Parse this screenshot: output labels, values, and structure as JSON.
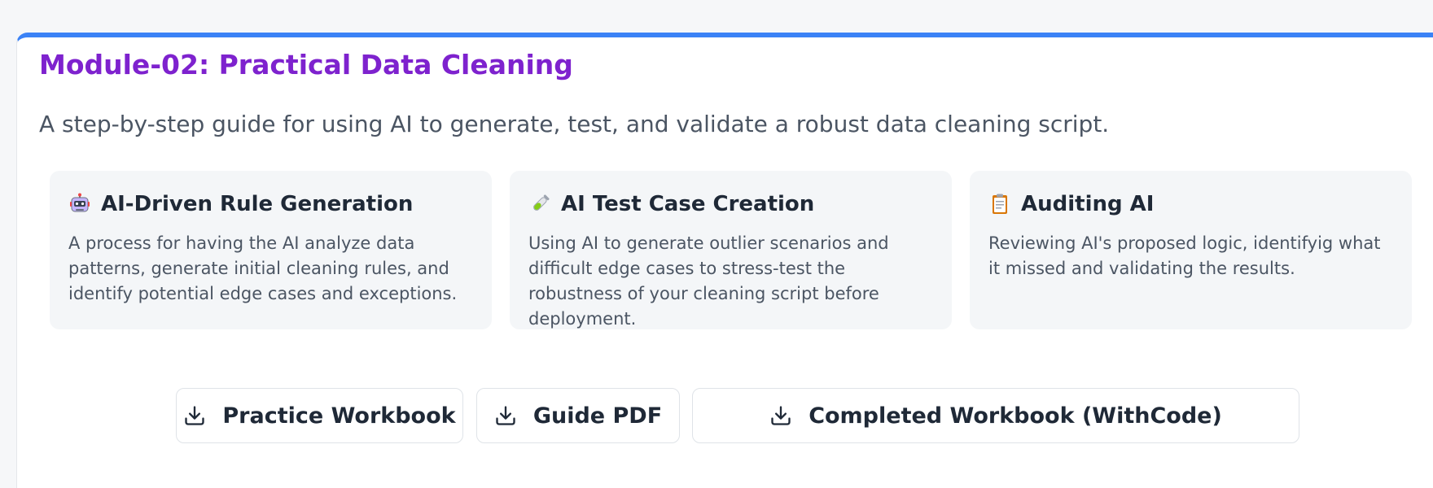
{
  "module": {
    "title": "Module-02: Practical Data Cleaning",
    "subtitle": "A step-by-step guide for using AI to generate, test, and validate a robust data cleaning script."
  },
  "features": [
    {
      "icon": "robot-icon",
      "title": "AI-Driven Rule Generation",
      "description": "A process for having the AI analyze data patterns, generate initial cleaning rules, and identify potential edge cases and exceptions."
    },
    {
      "icon": "test-tube-icon",
      "title": "AI Test Case Creation",
      "description": "Using AI to generate outlier scenarios and difficult edge cases to stress-test the robustness of your cleaning script before deployment."
    },
    {
      "icon": "clipboard-icon",
      "title": "Auditing AI",
      "description": "Reviewing AI's proposed logic, identifyig what it missed and validating the results."
    }
  ],
  "downloads": {
    "icon": "download-icon",
    "practice_label": "Practice Workbook",
    "guide_label": "Guide PDF",
    "completed_label": "Completed Workbook (WithCode)"
  },
  "colors": {
    "accent_bar": "#3b82f6",
    "title": "#7e22ce",
    "feature_bg": "#f4f6f8"
  }
}
